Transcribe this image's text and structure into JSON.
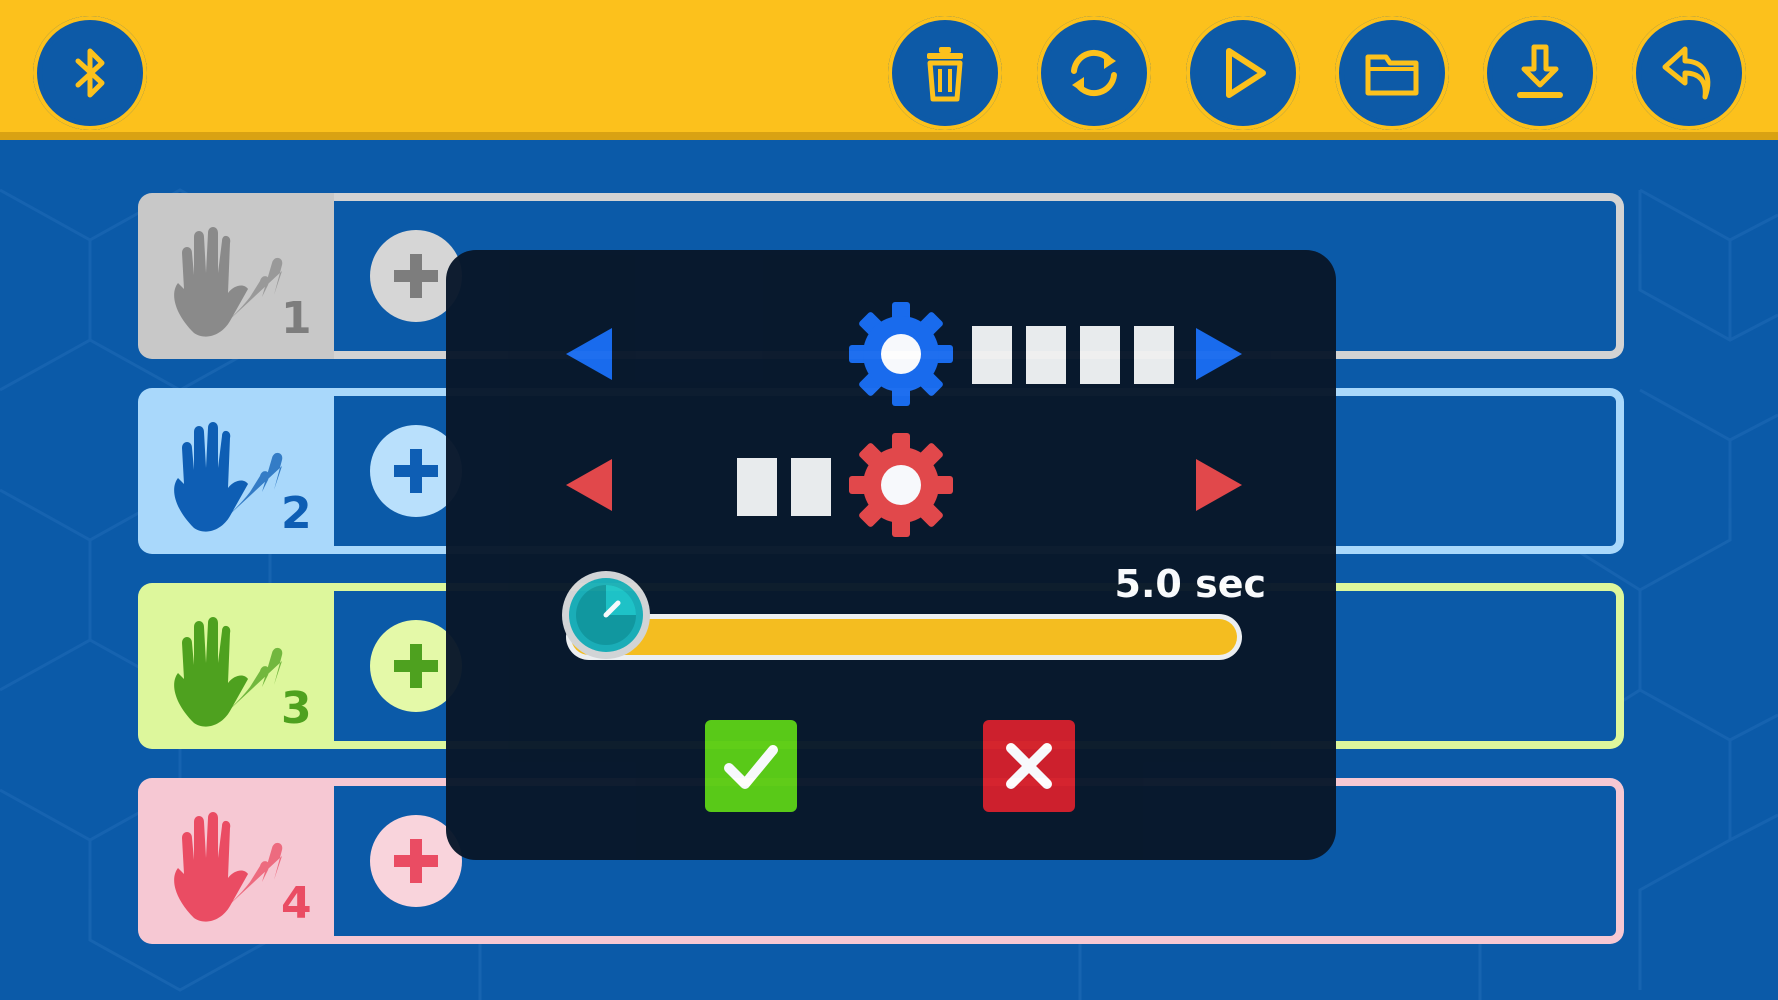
{
  "toolbar": {
    "left_buttons": [
      {
        "name": "bluetooth-button",
        "icon": "bluetooth-icon"
      }
    ],
    "right_buttons": [
      {
        "name": "delete-button",
        "icon": "trash-icon"
      },
      {
        "name": "sync-button",
        "icon": "refresh-icon"
      },
      {
        "name": "play-button",
        "icon": "play-icon"
      },
      {
        "name": "open-button",
        "icon": "folder-icon"
      },
      {
        "name": "download-button",
        "icon": "download-icon"
      },
      {
        "name": "undo-button",
        "icon": "undo-icon"
      }
    ],
    "color": "#fcc11c"
  },
  "rows": [
    {
      "number": "1",
      "badge_color": "#c8c8c8",
      "accent": "#7d7d7d",
      "lane_border": "#d3d3d3",
      "add_icon": "plus-icon"
    },
    {
      "number": "2",
      "badge_color": "#a9d8fb",
      "accent": "#0e5eb4",
      "lane_border": "#a9d8fb",
      "add_icon": "plus-icon"
    },
    {
      "number": "3",
      "badge_color": "#ddf79c",
      "accent": "#4ea11f",
      "lane_border": "#ddf79c",
      "add_icon": "plus-icon"
    },
    {
      "number": "4",
      "badge_color": "#f6c8d3",
      "accent": "#ea4c63",
      "lane_border": "#f6c8d3",
      "add_icon": "plus-icon"
    }
  ],
  "modal": {
    "motor_a": {
      "color": "#1a6cf0",
      "blocks_after_gear": 4,
      "blocks_before_gear": 0,
      "icon": "gear-icon"
    },
    "motor_b": {
      "color": "#e84848",
      "blocks_after_gear": 0,
      "blocks_before_gear": 2,
      "icon": "gear-icon"
    },
    "duration": {
      "label": "5.0 sec",
      "value_sec": 5.0,
      "fill_fraction": 1.0,
      "icon": "timer-icon"
    },
    "confirm_icon": "check-icon",
    "cancel_icon": "close-icon",
    "confirm_color": "#5ccd14",
    "cancel_color": "#d41f2a"
  }
}
